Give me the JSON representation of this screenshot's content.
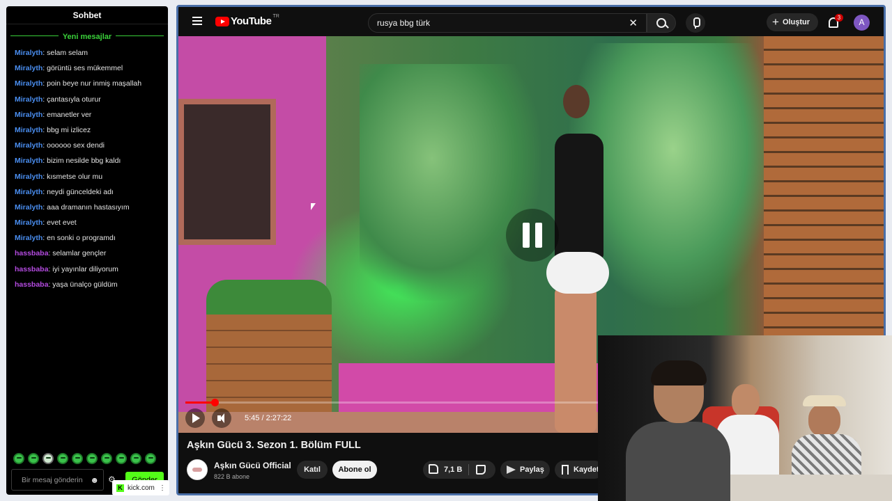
{
  "chat": {
    "title": "Sohbet",
    "new_messages_label": "Yeni mesajlar",
    "messages": [
      {
        "author": "Miralyth",
        "color": "#4a8ef0",
        "text": ": selam selam"
      },
      {
        "author": "Miralyth",
        "color": "#4a8ef0",
        "text": ": görüntü ses mükemmel"
      },
      {
        "author": "Miralyth",
        "color": "#4a8ef0",
        "text": ": poin beye nur inmiş maşallah"
      },
      {
        "author": "Miralyth",
        "color": "#4a8ef0",
        "text": ": çantasıyla oturur"
      },
      {
        "author": "Miralyth",
        "color": "#4a8ef0",
        "text": ": emanetler ver"
      },
      {
        "author": "Miralyth",
        "color": "#4a8ef0",
        "text": ": bbg mi izlicez"
      },
      {
        "author": "Miralyth",
        "color": "#4a8ef0",
        "text": ": oooooo sex dendi"
      },
      {
        "author": "Miralyth",
        "color": "#4a8ef0",
        "text": ": bizim nesilde bbg kaldı"
      },
      {
        "author": "Miralyth",
        "color": "#4a8ef0",
        "text": ": kısmetse olur mu"
      },
      {
        "author": "Miralyth",
        "color": "#4a8ef0",
        "text": ": neydi günceldeki adı"
      },
      {
        "author": "Miralyth",
        "color": "#4a8ef0",
        "text": ": aaa dramanın hastasıyım"
      },
      {
        "author": "Miralyth",
        "color": "#4a8ef0",
        "text": ": evet evet"
      },
      {
        "author": "Miralyth",
        "color": "#4a8ef0",
        "text": ": en sonki o programdı"
      },
      {
        "author": "hassbaba",
        "color": "#b44be0",
        "text": ": selamlar gençler"
      },
      {
        "author": "hassbaba",
        "color": "#b44be0",
        "text": ": iyi yayınlar diliyorum"
      },
      {
        "author": "hassbaba",
        "color": "#b44be0",
        "text": ": yaşa ünalço güldüm"
      }
    ],
    "emotes": [
      "frog-emote",
      "frog-emote",
      "panda-emote",
      "frog-emote",
      "frog-emote",
      "frog-emote",
      "frog-emote",
      "frog-emote",
      "frog-emote",
      "frog-emote"
    ],
    "input_placeholder": "Bir mesaj gönderin",
    "send_label": "Gönder",
    "accent": "#53fc18"
  },
  "kick_bar": {
    "url": "kick.com"
  },
  "youtube": {
    "logo_text": "YouTube",
    "region": "TR",
    "search_query": "rusya bbg türk",
    "create_label": "Oluştur",
    "notification_count": "3",
    "avatar_letter": "A",
    "player": {
      "time": "5:45 / 2:27:22",
      "progress": 0.042,
      "state": "paused"
    },
    "video_title": "Aşkın Gücü 3. Sezon 1. Bölüm FULL",
    "channel_name": "Aşkın Gücü Official",
    "subscribers": "822 B abone",
    "join_label": "Katıl",
    "subscribe_label": "Abone ol",
    "likes": "7,1 B",
    "share_label": "Paylaş",
    "save_label": "Kaydet"
  }
}
